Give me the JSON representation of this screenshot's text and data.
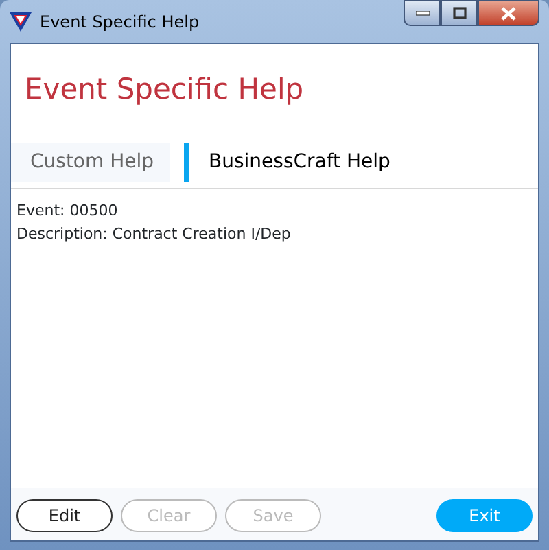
{
  "window": {
    "title": "Event Specific Help"
  },
  "heading": "Event Specific Help",
  "tabs": [
    {
      "label": "Custom Help",
      "selected": false
    },
    {
      "label": "BusinessCraft Help",
      "selected": true
    }
  ],
  "content": [
    "Event: 00500",
    "Description: Contract Creation I/Dep"
  ],
  "buttons": [
    {
      "label": "Edit",
      "kind": "outline",
      "disabled": false
    },
    {
      "label": "Clear",
      "kind": "outline",
      "disabled": true
    },
    {
      "label": "Save",
      "kind": "outline",
      "disabled": true
    },
    {
      "label": "Exit",
      "kind": "primary",
      "disabled": false
    }
  ]
}
